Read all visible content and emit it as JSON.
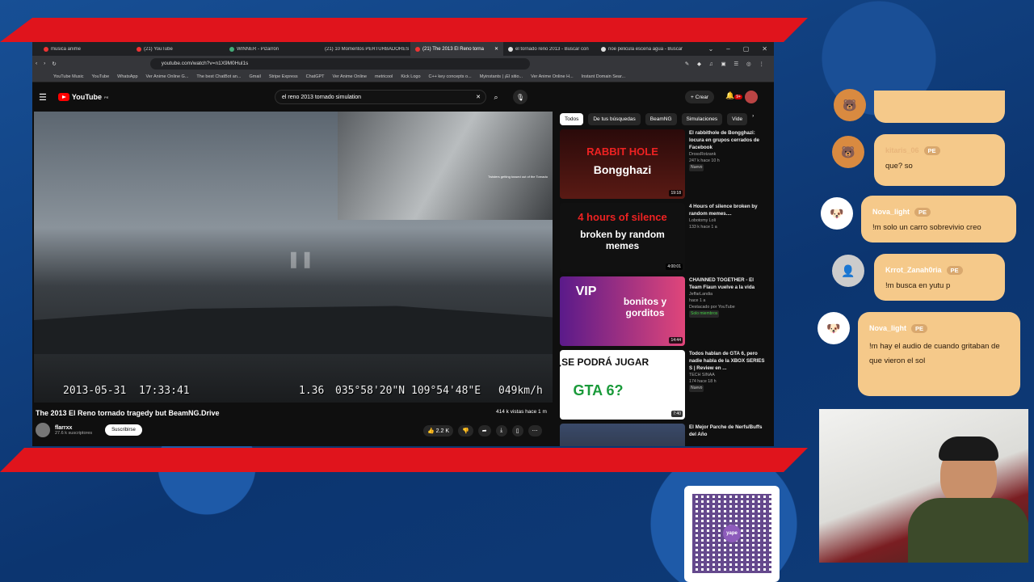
{
  "browser": {
    "tabs": [
      {
        "label": "musica anime"
      },
      {
        "label": "(21) YouTube"
      },
      {
        "label": "WINNER - Pizarrón"
      },
      {
        "label": "(21) 10 Momentos PERTURBADORES"
      },
      {
        "label": "(21) The 2013 El Reno torna"
      },
      {
        "label": "el tornado reno 2013 - Buscar con"
      },
      {
        "label": "noe pelicula escena agua - Buscar"
      }
    ],
    "url": "youtube.com/watch?v=n1X9M0Hul1s",
    "bookmarks": [
      "YouTube Music",
      "YouTube",
      "WhatsApp",
      "Ver Anime Online G...",
      "The best ChatBot an...",
      "Gmail",
      "Stripe Express",
      "ChatGPT",
      "Ver Anime Online",
      "metricool",
      "Kick Logo",
      "C++ key concepts o...",
      "Myinstants | ¡El sitio...",
      "Ver Anime Online H...",
      "Instant Domain Sear..."
    ]
  },
  "youtube": {
    "logo": "YouTube",
    "country": "PE",
    "search_query": "el reno 2013 tornado simulation",
    "create_label": "Crear",
    "notif_count": "9+",
    "video": {
      "title": "The 2013 El Reno tornado tragedy but BeamNG.Drive",
      "channel": "flarrxx",
      "subscribers": "27.6 k suscriptores",
      "subscribe_label": "Suscribirse",
      "views": "414 k vistas  hace 1 m",
      "likes": "2.2 K",
      "overlay_date": "2013-05-31",
      "overlay_time": "17:33:41",
      "overlay_value": "1.36",
      "overlay_lat": "035°58'20\"N",
      "overlay_lon": "109°54'48\"E",
      "overlay_speed": "049km/h",
      "pip_text": "Twisters getting tossed out of the Tornado"
    },
    "chips": [
      "Todos",
      "De tus búsquedas",
      "BeamNG",
      "Simulaciones",
      "Vide"
    ],
    "recommendations": [
      {
        "title": "El rabbithole de Bongghazi: locura en grupos cerrados de Facebook",
        "channel": "DrossRotzank",
        "meta": "247 k  hace 10 h",
        "badge": "Nuevo",
        "duration": "19:18",
        "thumb_top": "RABBIT HOLE",
        "thumb_bottom": "Bongghazi"
      },
      {
        "title": "4 Hours of silence broken by random memes....",
        "channel": "Lobotomy Loli",
        "meta": "133 k  hace 1 a",
        "badge": "",
        "duration": "4:00:01",
        "thumb_top": "4 hours of silence",
        "thumb_bottom": "broken by random memes"
      },
      {
        "title": "CHAINNED TOGETHER - El Team Flaun vuelve a la vida",
        "channel": "JeffarLandia",
        "meta": "hace 1 a",
        "badge": "Destacado por YouTube",
        "badge2": "Solo miembros",
        "duration": "14:44",
        "thumb_top": "VIP",
        "thumb_bottom": "bonitos y gorditos"
      },
      {
        "title": "Todos hablan de GTA 6, pero nadie habla de la XBOX SERIES S | Review en ...",
        "channel": "TECH SINAA",
        "meta": "174  hace 18 h",
        "badge": "Nuevo",
        "duration": "7:40",
        "thumb_top": "¿SE PODRÁ JUGAR",
        "thumb_bottom": "GTA 6?"
      },
      {
        "title": "El Mejor Parche de Nerfs/Buffs del Año",
        "channel": "",
        "meta": "",
        "badge": "",
        "duration": "",
        "thumb_top": "",
        "thumb_bottom": ""
      }
    ]
  },
  "chat": [
    {
      "name": "",
      "msg": "",
      "pe": ""
    },
    {
      "name": "kitaris_06",
      "msg": "que? so",
      "pe": "PE"
    },
    {
      "name": "Nova_light",
      "msg": "!m solo un carro sobrevivio creo",
      "pe": "PE"
    },
    {
      "name": "Krrot_Zanah0ria",
      "msg": "!m busca en yutu p",
      "pe": "PE"
    },
    {
      "name": "Nova_light",
      "msg": "!m hay el audio de cuando gritaban de que vieron el sol",
      "pe": "PE"
    }
  ],
  "qr": {
    "brand": "yape"
  },
  "colors": {
    "stream_red": "#e0141c",
    "chat_bubble": "#f5c98a",
    "yt_red": "#ff0000"
  }
}
